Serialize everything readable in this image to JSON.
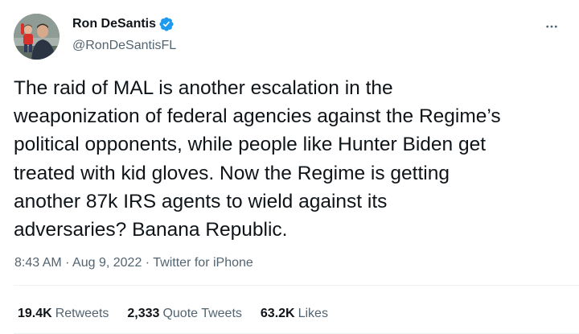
{
  "author": {
    "display_name": "Ron DeSantis",
    "handle": "@RonDeSantisFL",
    "verified_icon": "verified-badge-icon",
    "verified_color": "#1d9bf0"
  },
  "menu_icon": "more-horizontal-icon",
  "tweet": {
    "lines": [
      "The raid of MAL is another escalation in the",
      "weaponization of federal agencies against the Regime’s",
      "political opponents, while people like Hunter Biden get",
      "treated with kid gloves. Now the Regime is getting",
      "another 87k IRS agents to wield against its",
      "adversaries? Banana Republic."
    ]
  },
  "meta": {
    "time": "8:43 AM",
    "sep1": " · ",
    "date": "Aug 9, 2022",
    "sep2": " · ",
    "source": "Twitter for iPhone"
  },
  "stats": {
    "retweets_count": "19.4K",
    "retweets_label": "Retweets",
    "quotes_count": "2,333",
    "quotes_label": "Quote Tweets",
    "likes_count": "63.2K",
    "likes_label": "Likes"
  },
  "colors": {
    "text_primary": "#0f1419",
    "text_secondary": "#536471",
    "divider": "#eff3f4"
  }
}
